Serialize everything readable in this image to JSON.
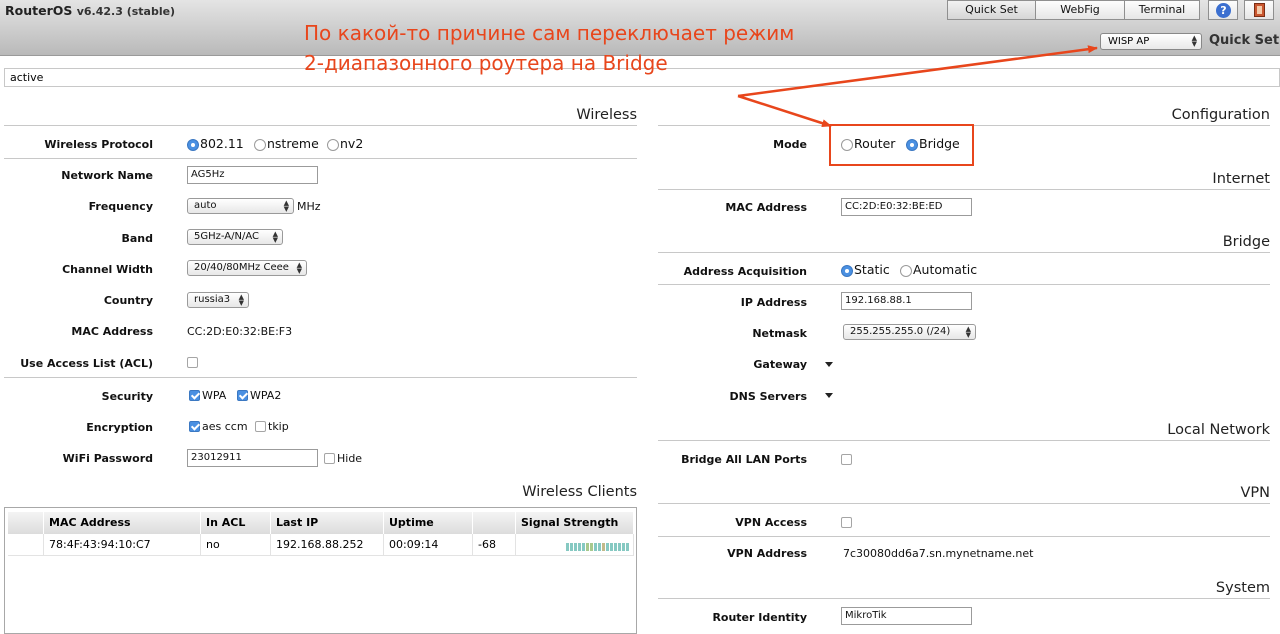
{
  "header": {
    "brand": "RouterOS",
    "version": "v6.42.3 (stable)",
    "buttons": [
      "Quick Set",
      "WebFig",
      "Terminal"
    ],
    "mode_select": "WISP AP",
    "title": "Quick Set"
  },
  "status": "active",
  "annotation": {
    "line1": "По какой-то причине сам переключает режим",
    "line2": "2-диапазонного роутера на Bridge",
    "color": "#e8461c"
  },
  "wireless": {
    "title": "Wireless",
    "protocol": {
      "label": "Wireless Protocol",
      "options": [
        "802.11",
        "nstreme",
        "nv2"
      ],
      "selected": "802.11"
    },
    "network_name": {
      "label": "Network Name",
      "value": "AG5Hz"
    },
    "frequency": {
      "label": "Frequency",
      "value": "auto",
      "unit": "MHz"
    },
    "band": {
      "label": "Band",
      "value": "5GHz-A/N/AC"
    },
    "channel_width": {
      "label": "Channel Width",
      "value": "20/40/80MHz Ceee"
    },
    "country": {
      "label": "Country",
      "value": "russia3"
    },
    "mac": {
      "label": "MAC Address",
      "value": "CC:2D:E0:32:BE:F3"
    },
    "acl": {
      "label": "Use Access List (ACL)",
      "checked": false
    },
    "security": {
      "label": "Security",
      "wpa": "WPA",
      "wpa2": "WPA2",
      "wpa_checked": true,
      "wpa2_checked": true
    },
    "encryption": {
      "label": "Encryption",
      "aes": "aes ccm",
      "tkip": "tkip",
      "aes_checked": true,
      "tkip_checked": false
    },
    "password": {
      "label": "WiFi Password",
      "value": "23012911",
      "hide": "Hide",
      "hide_checked": false
    }
  },
  "clients": {
    "title": "Wireless Clients",
    "columns": [
      "MAC Address",
      "In ACL",
      "Last IP",
      "Uptime",
      "",
      "Signal Strength"
    ],
    "rows": [
      {
        "mac": "78:4F:43:94:10:C7",
        "acl": "no",
        "ip": "192.168.88.252",
        "uptime": "00:09:14",
        "signal": "-68"
      }
    ]
  },
  "configuration": {
    "title": "Configuration",
    "mode": {
      "label": "Mode",
      "options": [
        "Router",
        "Bridge"
      ],
      "selected": "Bridge"
    }
  },
  "internet": {
    "title": "Internet",
    "mac": {
      "label": "MAC Address",
      "value": "CC:2D:E0:32:BE:ED"
    }
  },
  "bridge": {
    "title": "Bridge",
    "acquisition": {
      "label": "Address Acquisition",
      "options": [
        "Static",
        "Automatic"
      ],
      "selected": "Static"
    },
    "ip": {
      "label": "IP Address",
      "value": "192.168.88.1"
    },
    "netmask": {
      "label": "Netmask",
      "value": "255.255.255.0 (/24)"
    },
    "gateway": {
      "label": "Gateway"
    },
    "dns": {
      "label": "DNS Servers"
    }
  },
  "local_network": {
    "title": "Local Network",
    "bridge_all": {
      "label": "Bridge All LAN Ports",
      "checked": false
    }
  },
  "vpn": {
    "title": "VPN",
    "access": {
      "label": "VPN Access",
      "checked": false
    },
    "address": {
      "label": "VPN Address",
      "value": "7c30080dd6a7.sn.mynetname.net"
    }
  },
  "system": {
    "title": "System",
    "identity": {
      "label": "Router Identity",
      "value": "MikroTik"
    }
  }
}
